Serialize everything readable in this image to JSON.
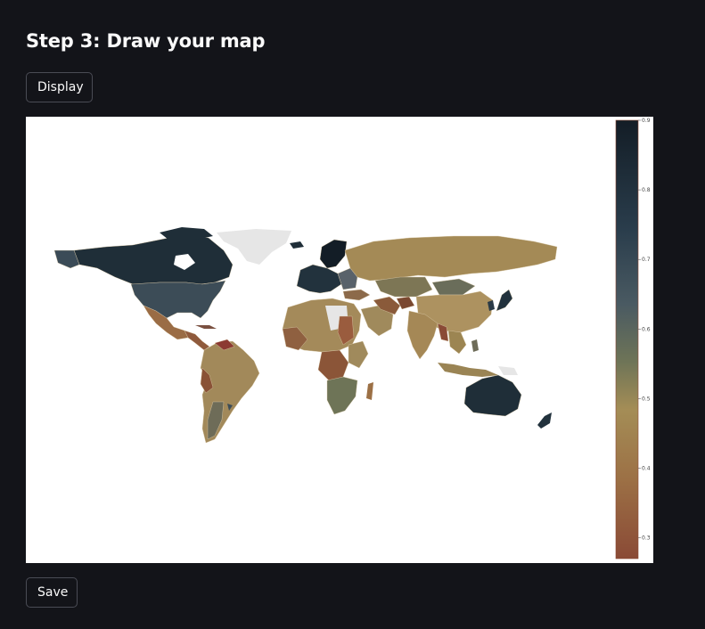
{
  "page": {
    "title": "Step 3: Draw your map"
  },
  "buttons": {
    "display_label": "Display",
    "save_label": "Save"
  },
  "map": {
    "type": "choropleth",
    "colorscale": {
      "min": 0.27,
      "max": 0.9,
      "ticks": [
        "0.9",
        "0.8",
        "0.7",
        "0.6",
        "0.5",
        "0.4",
        "0.3"
      ],
      "colors": [
        "#131d26",
        "#2a3d4c",
        "#4a5a62",
        "#6e7457",
        "#a48d56",
        "#9c7045",
        "#8a4a36"
      ]
    },
    "no_data_color": "#e6e6e6",
    "border_color": "#d9c9a8"
  }
}
